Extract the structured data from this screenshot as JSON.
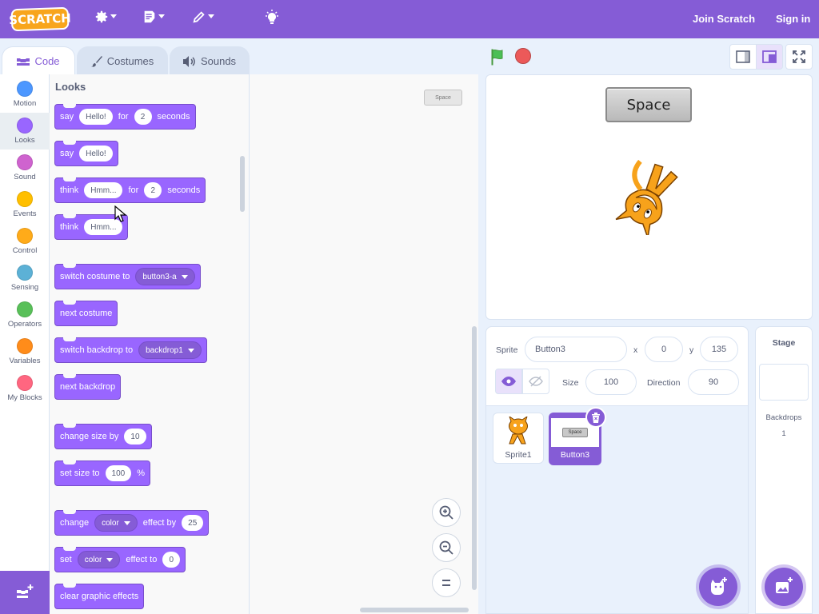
{
  "menubar": {
    "logo": "SCRATCH",
    "join": "Join Scratch",
    "signin": "Sign in"
  },
  "tabs": [
    "Code",
    "Costumes",
    "Sounds"
  ],
  "categories": [
    {
      "label": "Motion",
      "color": "#4c97ff"
    },
    {
      "label": "Looks",
      "color": "#9966ff"
    },
    {
      "label": "Sound",
      "color": "#cf63cf"
    },
    {
      "label": "Events",
      "color": "#ffbf00"
    },
    {
      "label": "Control",
      "color": "#ffab19"
    },
    {
      "label": "Sensing",
      "color": "#5cb1d6"
    },
    {
      "label": "Operators",
      "color": "#59c059"
    },
    {
      "label": "Variables",
      "color": "#ff8c1a"
    },
    {
      "label": "My Blocks",
      "color": "#ff6680"
    }
  ],
  "palette": {
    "title": "Looks",
    "b1": {
      "a": "say",
      "v1": "Hello!",
      "b": "for",
      "v2": "2",
      "c": "seconds"
    },
    "b2": {
      "a": "say",
      "v1": "Hello!"
    },
    "b3": {
      "a": "think",
      "v1": "Hmm...",
      "b": "for",
      "v2": "2",
      "c": "seconds"
    },
    "b4": {
      "a": "think",
      "v1": "Hmm..."
    },
    "b5": {
      "a": "switch costume to",
      "v1": "button3-a"
    },
    "b6": {
      "a": "next costume"
    },
    "b7": {
      "a": "switch backdrop to",
      "v1": "backdrop1"
    },
    "b8": {
      "a": "next backdrop"
    },
    "b9": {
      "a": "change size by",
      "v1": "10"
    },
    "b10": {
      "a": "set size to",
      "v1": "100",
      "b": "%"
    },
    "b11": {
      "a": "change",
      "v1": "color",
      "b": "effect by",
      "v2": "25"
    },
    "b12": {
      "a": "set",
      "v1": "color",
      "b": "effect to",
      "v2": "0"
    },
    "b13": {
      "a": "clear graphic effects"
    }
  },
  "workspace": {
    "sprite_thumb_text": "Space"
  },
  "stage": {
    "button_text": "Space"
  },
  "sprite_info": {
    "sprite_label": "Sprite",
    "sprite_name": "Button3",
    "x_label": "x",
    "x": "0",
    "y_label": "y",
    "y": "135",
    "size_label": "Size",
    "size": "100",
    "direction_label": "Direction",
    "direction": "90"
  },
  "sprites": [
    {
      "name": "Sprite1"
    },
    {
      "name": "Button3",
      "thumb_text": "Space"
    }
  ],
  "stage_pane": {
    "title": "Stage",
    "backdrops_label": "Backdrops",
    "backdrops_count": "1"
  }
}
